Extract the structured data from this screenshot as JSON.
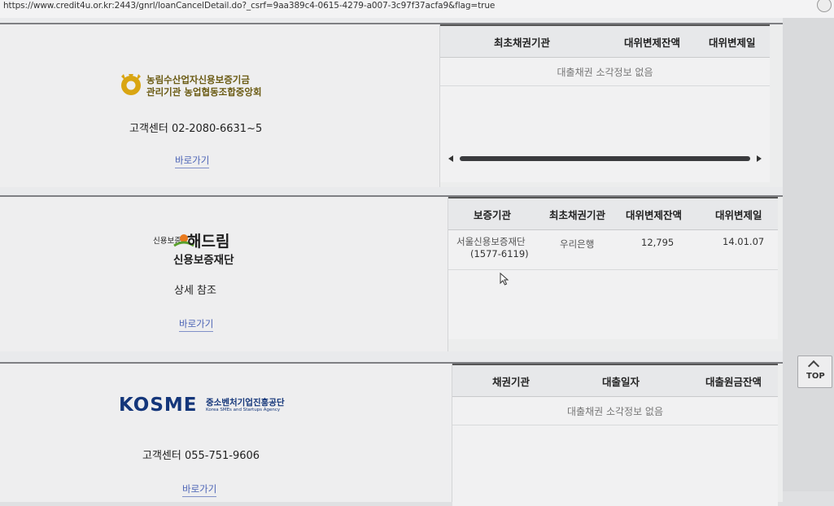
{
  "url": "https://www.credit4u.or.kr:2443/gnrl/loanCancelDetail.do?_csrf=9aa389c4-0615-4279-a007-3c97f37acfa9&flag=true",
  "colors": {
    "link": "#4a62b5",
    "kosme_blue": "#14367a",
    "nonghyup_gold": "#d9a512",
    "haedream_orange": "#e97a1e",
    "haedream_green": "#5aa02c"
  },
  "sections": [
    {
      "org_line1": "농림수산업자신용보증기금",
      "org_line2": "관리기관 농업협동조합중앙회",
      "contact": "고객센터 02-2080-6631~5",
      "link_label": "바로가기",
      "table": {
        "headers": [
          "최초채권기관",
          "대위변제잔액",
          "대위변제일"
        ],
        "empty_message": "대출채권 소각정보 없음"
      }
    },
    {
      "logo_small": "신용보증",
      "logo_big": "해드림",
      "logo_sub": "신용보증재단",
      "contact": "상세 참조",
      "link_label": "바로가기",
      "table": {
        "headers": [
          "보증기관",
          "최초채권기관",
          "대위변제잔액",
          "대위변제일"
        ],
        "rows": [
          {
            "guarantor": "서울신용보증재단",
            "guarantor_phone": "(1577-6119)",
            "original_creditor": "우리은행",
            "balance": "12,795",
            "date": "14.01.07"
          }
        ]
      }
    },
    {
      "logo_word": "KOSME",
      "logo_ko": "중소벤처기업진흥공단",
      "logo_en": "Korea SMEs and Startups Agency",
      "contact": "고객센터 055-751-9606",
      "link_label": "바로가기",
      "table": {
        "headers": [
          "채권기관",
          "대출일자",
          "대출원금잔액"
        ],
        "empty_message": "대출채권 소각정보 없음"
      }
    }
  ],
  "top_button": {
    "label": "TOP",
    "icon": "chevron-up-icon"
  }
}
